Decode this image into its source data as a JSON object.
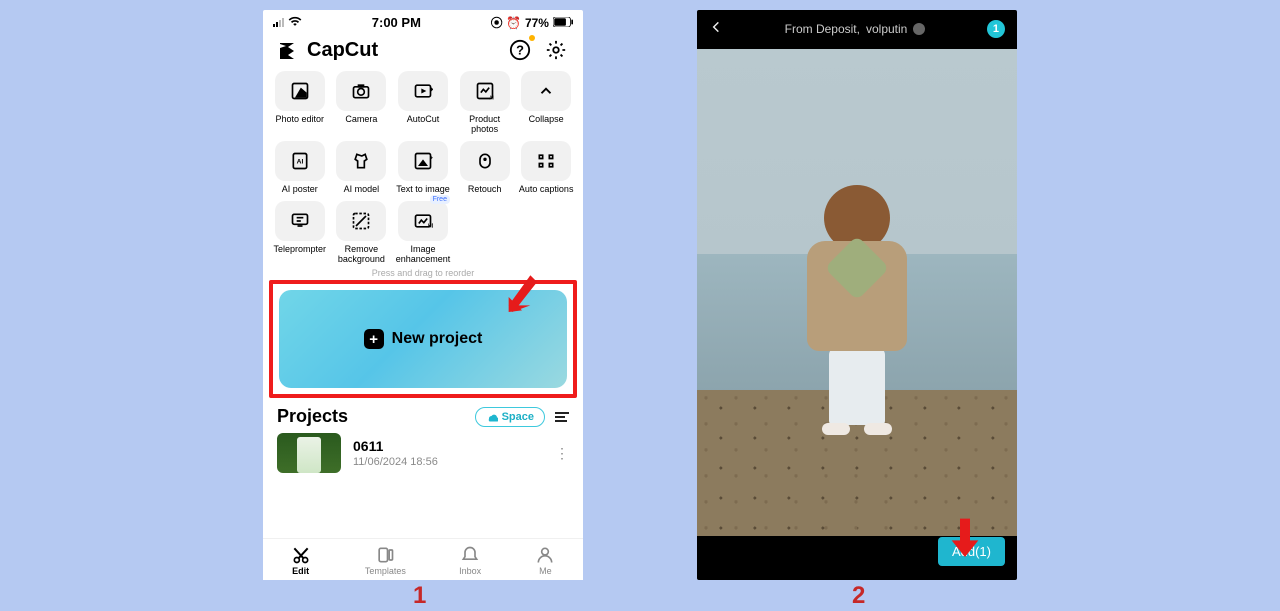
{
  "step_labels": {
    "one": "1",
    "two": "2"
  },
  "status": {
    "time": "7:00 PM",
    "battery_pct": "77%"
  },
  "brand": {
    "name": "CapCut"
  },
  "tools": [
    {
      "label": "Photo editor"
    },
    {
      "label": "Camera"
    },
    {
      "label": "AutoCut"
    },
    {
      "label": "Product photos"
    },
    {
      "label": "Collapse"
    },
    {
      "label": "AI poster"
    },
    {
      "label": "AI model"
    },
    {
      "label": "Text to image"
    },
    {
      "label": "Retouch"
    },
    {
      "label": "Auto captions"
    },
    {
      "label": "Teleprompter"
    },
    {
      "label": "Remove background"
    },
    {
      "label": "Image enhancement",
      "badge": "Free"
    }
  ],
  "reorder_hint": "Press and drag to reorder",
  "new_project_label": "New project",
  "projects": {
    "heading": "Projects",
    "space_label": "Space",
    "items": [
      {
        "title": "0611",
        "date": "11/06/2024 18:56"
      }
    ]
  },
  "nav": {
    "edit": "Edit",
    "templates": "Templates",
    "inbox": "Inbox",
    "me": "Me"
  },
  "picker": {
    "title_prefix": "From Deposit,",
    "title_user": "volputin",
    "count": "1",
    "add_label": "Add(1)"
  }
}
